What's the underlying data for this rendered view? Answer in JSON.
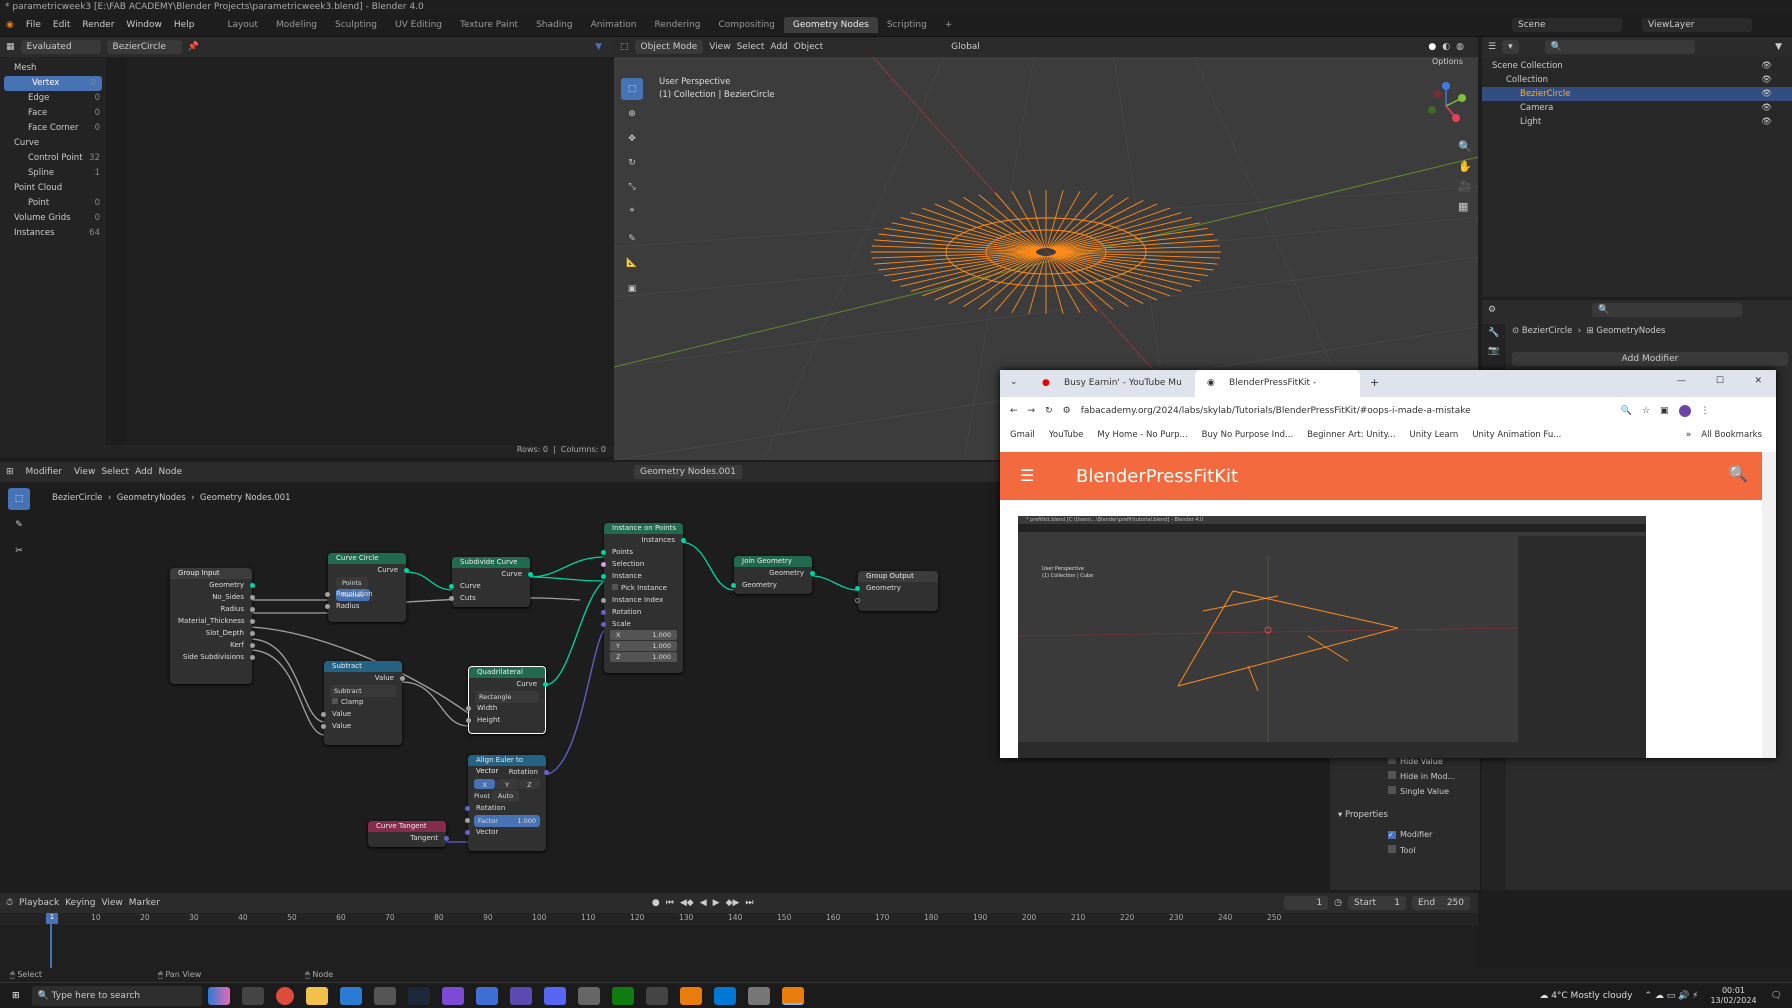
{
  "window_title": "* parametricweek3 [E:\\FAB ACADEMY\\Blender Projects\\parametricweek3.blend] - Blender 4.0",
  "menu": [
    "File",
    "Edit",
    "Render",
    "Window",
    "Help"
  ],
  "workspaces": [
    "Layout",
    "Modeling",
    "Sculpting",
    "UV Editing",
    "Texture Paint",
    "Shading",
    "Animation",
    "Rendering",
    "Compositing",
    "Geometry Nodes",
    "Scripting"
  ],
  "active_workspace": "Geometry Nodes",
  "scene": "Scene",
  "viewlayer": "ViewLayer",
  "spreadsheet": {
    "mode": "Evaluated",
    "object": "BezierCircle",
    "rows": "Rows: 0",
    "columns": "Columns: 0",
    "items": [
      {
        "label": "Mesh",
        "count": "",
        "level": 0
      },
      {
        "label": "Vertex",
        "count": "0",
        "level": 1,
        "active": true
      },
      {
        "label": "Edge",
        "count": "0",
        "level": 1
      },
      {
        "label": "Face",
        "count": "0",
        "level": 1
      },
      {
        "label": "Face Corner",
        "count": "0",
        "level": 1
      },
      {
        "label": "Curve",
        "count": "",
        "level": 0
      },
      {
        "label": "Control Point",
        "count": "32",
        "level": 1
      },
      {
        "label": "Spline",
        "count": "1",
        "level": 1
      },
      {
        "label": "Point Cloud",
        "count": "",
        "level": 0
      },
      {
        "label": "Point",
        "count": "0",
        "level": 1
      },
      {
        "label": "Volume Grids",
        "count": "0",
        "level": 0
      },
      {
        "label": "Instances",
        "count": "64",
        "level": 0
      }
    ]
  },
  "viewport": {
    "mode": "Object Mode",
    "menus": [
      "View",
      "Select",
      "Add",
      "Object"
    ],
    "transform": "Global",
    "title": "User Perspective",
    "subtitle": "(1) Collection | BezierCircle",
    "options": "Options"
  },
  "outliner": {
    "rows": [
      {
        "label": "Scene Collection",
        "indent": 0
      },
      {
        "label": "Collection",
        "indent": 1
      },
      {
        "label": "BezierCircle",
        "indent": 2,
        "active": true
      },
      {
        "label": "Camera",
        "indent": 2
      },
      {
        "label": "Light",
        "indent": 2
      }
    ]
  },
  "properties": {
    "breadcrumb_obj": "BezierCircle",
    "breadcrumb_mod": "GeometryNodes",
    "add_modifier": "Add Modifier",
    "checks": [
      "Hide Value",
      "Hide in Mod...",
      "Single Value"
    ],
    "section": "Properties",
    "props": [
      {
        "label": "Modifier",
        "checked": true
      },
      {
        "label": "Tool",
        "checked": false
      }
    ]
  },
  "node_editor": {
    "header_menus": [
      "Modifier",
      "View",
      "Select",
      "Add",
      "Node"
    ],
    "tree": "Geometry Nodes.001",
    "breadcrumb": [
      "BezierCircle",
      "GeometryNodes",
      "Geometry Nodes.001"
    ],
    "nodes": {
      "group_input": {
        "title": "Group Input",
        "outputs": [
          "Geometry",
          "No_Sides",
          "Radius",
          "Material_Thickness",
          "Slot_Depth",
          "Kerf",
          "Side Subdivisions"
        ]
      },
      "curve_circle": {
        "title": "Curve Circle",
        "out": "Curve",
        "btn1": "Points",
        "btn2": "Radius",
        "inputs": [
          "Resolution",
          "Radius"
        ]
      },
      "subdivide": {
        "title": "Subdivide Curve",
        "out": "Curve",
        "inputs": [
          "Curve",
          "Cuts"
        ]
      },
      "instance": {
        "title": "Instance on Points",
        "out": "Instances",
        "inputs": [
          "Points",
          "Selection",
          "Instance",
          "Pick Instance",
          "Instance Index",
          "Rotation",
          "Scale"
        ],
        "scale": [
          {
            "axis": "X",
            "value": "1.000"
          },
          {
            "axis": "Y",
            "value": "1.000"
          },
          {
            "axis": "Z",
            "value": "1.000"
          }
        ]
      },
      "join": {
        "title": "Join Geometry",
        "out": "Geometry",
        "in": "Geometry"
      },
      "output": {
        "title": "Group Output",
        "in": "Geometry"
      },
      "subtract": {
        "title": "Subtract",
        "out": "Value",
        "op": "Subtract",
        "clamp": "Clamp",
        "inputs": [
          "Value",
          "Value"
        ]
      },
      "quad": {
        "title": "Quadrilateral",
        "out": "Curve",
        "mode": "Rectangle",
        "inputs": [
          "Width",
          "Height"
        ]
      },
      "align": {
        "title": "Align Euler to Vector",
        "out": "Rotation",
        "axes": [
          "X",
          "Y",
          "Z"
        ],
        "pivot_label": "Pivot",
        "pivot": "Auto",
        "inputs": [
          "Rotation",
          "Factor",
          "Vector"
        ],
        "factor": "1.000"
      },
      "tangent": {
        "title": "Curve Tangent",
        "out": "Tangent"
      }
    }
  },
  "timeline": {
    "menus": [
      "Playback",
      "Keying",
      "View",
      "Marker"
    ],
    "frame": "1",
    "start_label": "Start",
    "start": "1",
    "end_label": "End",
    "end": "250",
    "ticks": [
      "1",
      "10",
      "20",
      "30",
      "40",
      "50",
      "60",
      "70",
      "80",
      "90",
      "100",
      "110",
      "120",
      "130",
      "140",
      "150",
      "160",
      "170",
      "180",
      "190",
      "200",
      "210",
      "220",
      "230",
      "240",
      "250"
    ]
  },
  "status": {
    "select": "Select",
    "pan": "Pan View",
    "node": "Node"
  },
  "browser": {
    "tabs": [
      "Busy Earnin' - YouTube Mu",
      "BlenderPressFitKit - Skylab/wor"
    ],
    "url": "fabacademy.org/2024/labs/skylab/Tutorials/BlenderPressFitKit/#oops-i-made-a-mistake",
    "bookmarks": [
      "Gmail",
      "YouTube",
      "My Home - No Purp...",
      "Buy No Purpose Ind...",
      "Beginner Art: Unity...",
      "Unity Learn",
      "Unity Animation Fu..."
    ],
    "all_bookmarks": "All Bookmarks",
    "site_title": "BlenderPressFitKit",
    "shot_title": "* prefitkit.blend [C:\\Users\\...\\Blender\\prefit\\tutorial.blend] - Blender 4.0",
    "shot_lines": [
      "User Perspective",
      "(1) Collection | Cube"
    ]
  },
  "taskbar": {
    "search": "Type here to search",
    "weather": "4°C  Mostly cloudy",
    "time": "00:01",
    "date": "13/02/2024"
  },
  "colors": {
    "accent": "#4772b3",
    "orange": "#ff8c1a",
    "geo": "#00d6a3",
    "browser_header": "#f26a3d"
  }
}
